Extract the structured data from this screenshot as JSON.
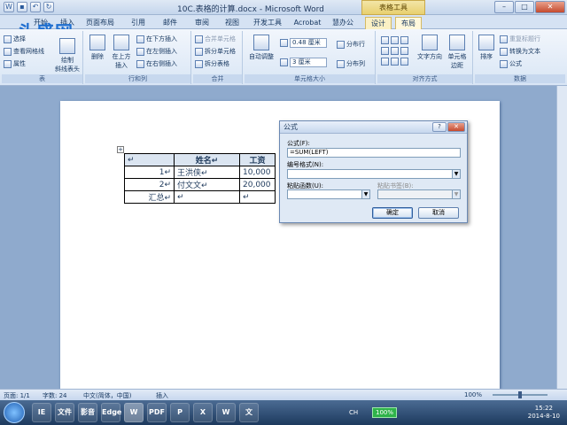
{
  "window": {
    "title": "10C.表格的计算.docx - Microsoft Word",
    "context_tools": "表格工具"
  },
  "watermark": {
    "text": "头盛网",
    "sub": "www"
  },
  "tabs": [
    "开始",
    "插入",
    "页面布局",
    "引用",
    "邮件",
    "审阅",
    "视图",
    "开发工具",
    "Acrobat",
    "慧办公",
    "设计",
    "布局"
  ],
  "active_tab": "布局",
  "ribbon": {
    "table_group": {
      "label": "表",
      "items": [
        "选择",
        "查看网格线",
        "属性"
      ]
    },
    "draw": {
      "label": "绘制\n斜线表头"
    },
    "rows_cols": {
      "label": "行和列",
      "delete": "删除",
      "insert_above": "在上方\n插入",
      "insert_below": "在下方插入",
      "insert_left": "在左侧插入",
      "insert_right": "在右侧插入"
    },
    "merge": {
      "label": "合并",
      "items": [
        "合并单元格",
        "拆分单元格",
        "拆分表格"
      ]
    },
    "cell_size": {
      "label": "单元格大小",
      "autofit": "自动调整",
      "height": "0.48 厘米",
      "width": "3 厘米",
      "dist_rows": "分布行",
      "dist_cols": "分布列"
    },
    "align": {
      "label": "对齐方式",
      "text_dir": "文字方向",
      "margins": "单元格\n边距"
    },
    "data": {
      "label": "数据",
      "sort": "排序",
      "repeat_header": "重复标题行",
      "to_text": "转换为文本",
      "formula": "公式"
    }
  },
  "table": {
    "headers": [
      "↵",
      "姓名↵",
      "工资"
    ],
    "rows": [
      [
        "1↵",
        "王洪侠↵",
        "10,000"
      ],
      [
        "2↵",
        "付文文↵",
        "20,000"
      ],
      [
        "汇总↵",
        "↵",
        "↵"
      ]
    ]
  },
  "dialog": {
    "title": "公式",
    "help": "?",
    "formula_label": "公式(F):",
    "formula_value": "=SUM(LEFT)",
    "number_format_label": "编号格式(N):",
    "number_format_value": "",
    "paste_function_label": "粘贴函数(U):",
    "paste_bookmark_label": "粘贴书签(B):",
    "ok": "确定",
    "cancel": "取消"
  },
  "statusbar": {
    "page": "页面: 1/1",
    "words": "字数: 24",
    "language": "中文(简体，中国)",
    "mode": "插入",
    "zoom": "100%",
    "zoom_level": 0.5
  },
  "taskbar": {
    "apps": [
      "IE",
      "文件",
      "影音",
      "Edge",
      "W",
      "PDF",
      "P",
      "X",
      "W",
      "文"
    ],
    "battery": "100%",
    "time": "15:22",
    "date": "2014-8-10",
    "ime": "CH"
  }
}
